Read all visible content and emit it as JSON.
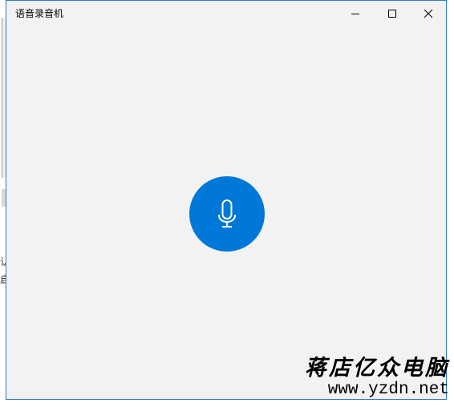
{
  "window": {
    "title": "语音录音机"
  },
  "background_window": {
    "text_line_1": "认",
    "text_line_2": "启"
  },
  "record_button": {
    "icon": "microphone-icon",
    "color": "#0078d7"
  },
  "watermark": {
    "brand": "蒋店亿众电脑",
    "url": "www.yzdn.net"
  },
  "colors": {
    "accent": "#0078d7",
    "window_bg": "#f2f2f2",
    "border": "#2b78d0"
  }
}
